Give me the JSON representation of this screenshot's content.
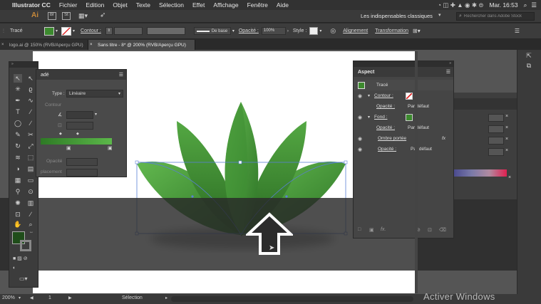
{
  "menubar": {
    "app": "Illustrator CC",
    "items": [
      "Fichier",
      "Edition",
      "Objet",
      "Texte",
      "Sélection",
      "Effet",
      "Affichage",
      "Fenêtre",
      "Aide"
    ],
    "clock": "Mar. 16:53"
  },
  "appbar": {
    "logo": "Ai",
    "workspace": "Les indispensables classiques",
    "search_placeholder": "Rechercher dans Adobe Stock"
  },
  "control": {
    "object_type": "Tracé",
    "stroke_label": "Contour :",
    "stroke_style": "De base",
    "opacity_label": "Opacité :",
    "opacity_value": "100%",
    "style_label": "Style :",
    "align_label": "Alignement",
    "transform_label": "Transformation",
    "fill_color": "#3c8a2e"
  },
  "tabs": [
    {
      "label": "logo.ai @ 150% (RVB/Aperçu GPU)"
    },
    {
      "label": "Sans titre - 8* @ 200% (RVB/Aperçu GPU)"
    }
  ],
  "gradient_panel": {
    "title_fragment": "adé",
    "type_label": "Type :",
    "type_value": "Linéaire",
    "stroke_label": "Contour",
    "opacity_label": "Opacité",
    "location_label": "placement"
  },
  "appearance_panel": {
    "title": "Aspect",
    "object": "Tracé",
    "rows": [
      {
        "label": "Contour :",
        "value": ""
      },
      {
        "label": "Opacité :",
        "value": "Par défaut"
      },
      {
        "label": "Fond :",
        "value": ""
      },
      {
        "label": "Opacité :",
        "value": "Par défaut"
      },
      {
        "label": "Ombre portée",
        "value": ""
      },
      {
        "label": "Opacité :",
        "value": "Par défaut"
      }
    ]
  },
  "status": {
    "zoom": "200%",
    "page": "1",
    "tool": "Sélection"
  },
  "watermark": "Activer Windows"
}
